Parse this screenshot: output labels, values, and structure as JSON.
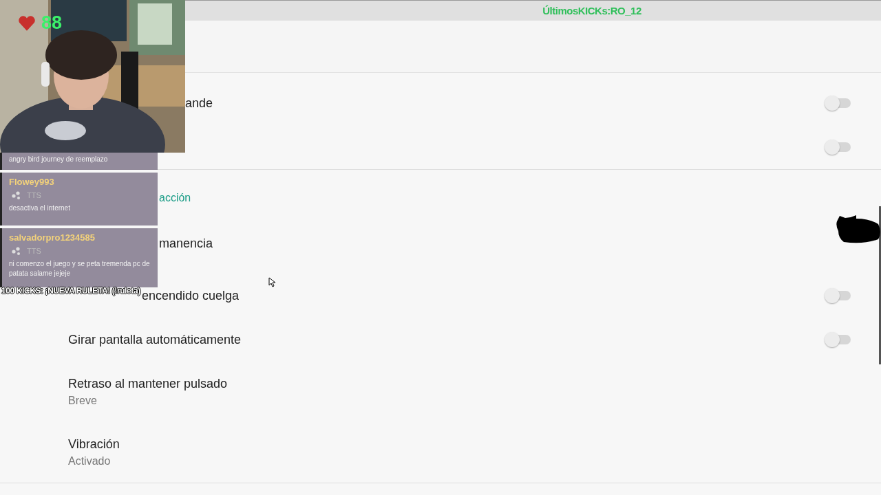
{
  "top_banner": {
    "text": "ÚltimosKICKs:RO_12"
  },
  "settings": [
    {
      "kind": "toggle",
      "title": "ande",
      "under_webcam": true,
      "on": false
    },
    {
      "kind": "toggle",
      "on": false
    },
    {
      "kind": "divider"
    },
    {
      "kind": "header",
      "title": "acción",
      "under_chat": true
    },
    {
      "kind": "summary",
      "title": "manencia",
      "under_chat": true
    },
    {
      "kind": "toggle",
      "title": "encendido cuelga",
      "under_banner": true,
      "on": false
    },
    {
      "kind": "toggle",
      "title": "Girar pantalla automáticamente",
      "on": false
    },
    {
      "kind": "summary",
      "title": "Retraso al mantener pulsado",
      "summary": "Breve"
    },
    {
      "kind": "summary",
      "title": "Vibración",
      "summary": "Activado"
    },
    {
      "kind": "divider"
    }
  ],
  "webcam": {
    "kind": "picture",
    "hearts": "88"
  },
  "chat": [
    {
      "message": "angry bird journey de reemplazo"
    },
    {
      "user": "Flowey993",
      "badge": "TTS",
      "message": "desactiva el internet"
    },
    {
      "user": "salvadorpro1234585",
      "badge": "TTS",
      "message": "ni comenzo el juego y se peta tremenda pc de patata salame jejeje"
    }
  ],
  "kicks_banner": "100 KICKS: ¡NUEVA RULETA! (!ruleta)"
}
